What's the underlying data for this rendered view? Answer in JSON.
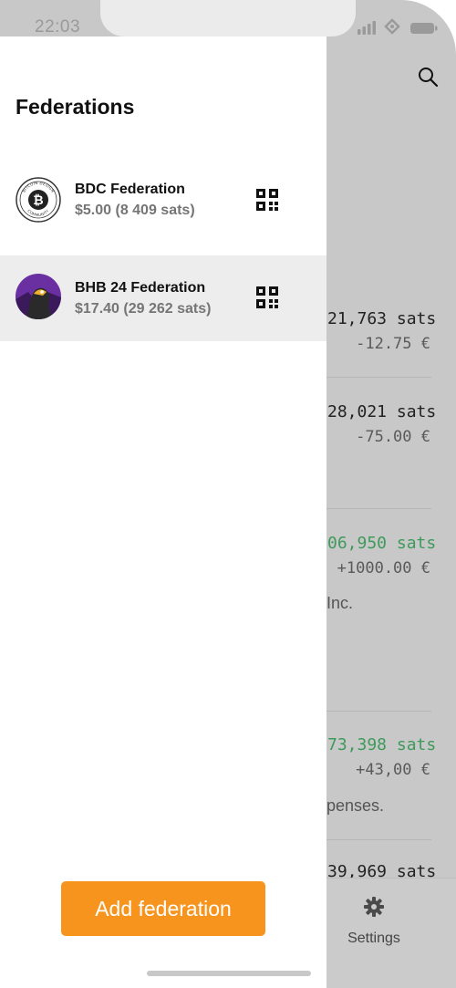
{
  "status_bar": {
    "time": "22:03"
  },
  "drawer": {
    "title": "Federations",
    "federations": [
      {
        "name": "BDC Federation",
        "balance": "$5.00 (8 409 sats)",
        "logo_text": "BITCOIN DESIGN COMMUNITY",
        "selected": false
      },
      {
        "name": "BHB 24 Federation",
        "balance": "$17.40 (29 262 sats)",
        "selected": true
      }
    ],
    "add_button_label": "Add federation"
  },
  "background": {
    "transactions": [
      {
        "amount": "21,763 sats",
        "fiat": "-12.75 €",
        "amount_color": "#222222",
        "description": ""
      },
      {
        "amount": "28,021 sats",
        "fiat": "-75.00 €",
        "amount_color": "#222222",
        "description": ""
      },
      {
        "amount": "06,950 sats",
        "fiat": "+1000.00 €",
        "amount_color": "#3e9a5a",
        "description": "Inc."
      },
      {
        "amount": "73,398 sats",
        "fiat": "+43,00 €",
        "amount_color": "#3e9a5a",
        "description": "penses."
      },
      {
        "amount": "39,969 sats",
        "fiat": "",
        "amount_color": "#222222",
        "description": ""
      }
    ],
    "tabbar": {
      "settings_label": "Settings"
    }
  },
  "colors": {
    "accent": "#f7941d",
    "selected_row": "#ededed",
    "positive": "#3e9a5a"
  },
  "icons": [
    "search-icon",
    "gear-icon",
    "qr-code-icon",
    "signal-icon",
    "wifi-icon",
    "battery-icon"
  ]
}
